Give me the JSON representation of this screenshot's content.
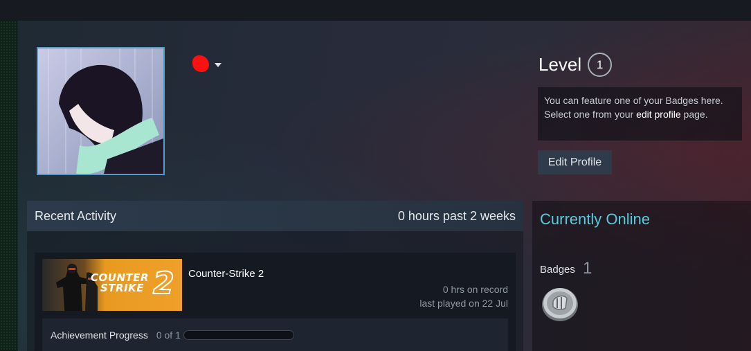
{
  "profile": {
    "level_label": "Level",
    "level_value": "1",
    "badge_notice_line1": "You can feature one of your Badges here.",
    "badge_notice_line2_prefix": "Select one from your ",
    "badge_notice_link": "edit profile",
    "badge_notice_line2_suffix": " page.",
    "edit_profile_label": "Edit Profile"
  },
  "activity": {
    "title": "Recent Activity",
    "hours_summary": "0 hours past 2 weeks",
    "game": {
      "capsule_line1": "COUNTER",
      "capsule_line2": "STRIKE",
      "capsule_number": "2",
      "name": "Counter-Strike 2",
      "hours_on_record": "0 hrs on record",
      "last_played": "last played on 22 Jul",
      "achievement_label": "Achievement Progress",
      "achievement_count": "0 of 1",
      "achievement_progress": 0
    }
  },
  "sidebar": {
    "status": "Currently Online",
    "badges_label": "Badges",
    "badges_count": "1"
  },
  "colors": {
    "accent_online": "#57cbde",
    "redaction": "#ff1010"
  }
}
